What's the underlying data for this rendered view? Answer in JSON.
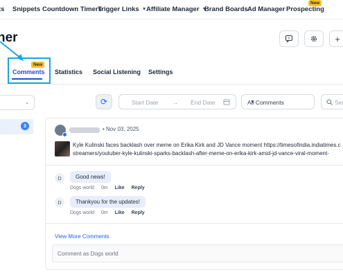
{
  "nav": {
    "items": [
      {
        "label": "Snippets",
        "dropdown": false
      },
      {
        "label": "Countdown Timers",
        "dropdown": false
      },
      {
        "label": "Trigger Links",
        "dropdown": true
      },
      {
        "label": "Affiliate Manager",
        "dropdown": true
      },
      {
        "label": "Brand Boards",
        "dropdown": false
      },
      {
        "label": "Ad Manager",
        "dropdown": false
      },
      {
        "label": "Prospecting",
        "dropdown": false
      }
    ],
    "first_partial": "ts",
    "prospecting_badge": "New"
  },
  "page": {
    "title_partial": "her"
  },
  "tabs": {
    "items": [
      "Comments",
      "Statistics",
      "Social Listening",
      "Settings"
    ],
    "active": "Comments",
    "new_badge": "New"
  },
  "filters": {
    "start_date_placeholder": "Start Date",
    "end_date_placeholder": "End Date",
    "comment_filter": "All Comments",
    "search_placeholder": "Sea"
  },
  "left_panel": {
    "badge_count": "3"
  },
  "post": {
    "date": "Nov 03, 2025",
    "text_line1": "Kyle Kulinski faces backlash over meme on Erika Kirk and JD Vance moment https://timesofindia.indiatimes.c",
    "text_line2": "streamers/youtuber-kyle-kulinski-sparks-backlash-after-meme-on-erika-kirk-amid-jd-vance-viral-moment-"
  },
  "comments": [
    {
      "avatar_initial": "D",
      "text": "Good news!",
      "author": "Dogs world",
      "time": "0m",
      "like_label": "Like",
      "reply_label": "Reply"
    },
    {
      "avatar_initial": "D",
      "text": "Thankyou for the updates!",
      "author": "Dogs world",
      "time": "0m",
      "like_label": "Like",
      "reply_label": "Reply"
    }
  ],
  "view_more_label": "View More Comments",
  "reply_placeholder": "Comment as Dogs world",
  "colors": {
    "accent": "#1d4ed8",
    "highlight": "#1aa3e8",
    "badge": "#fbbf24",
    "bubble": "#e8edfb"
  }
}
